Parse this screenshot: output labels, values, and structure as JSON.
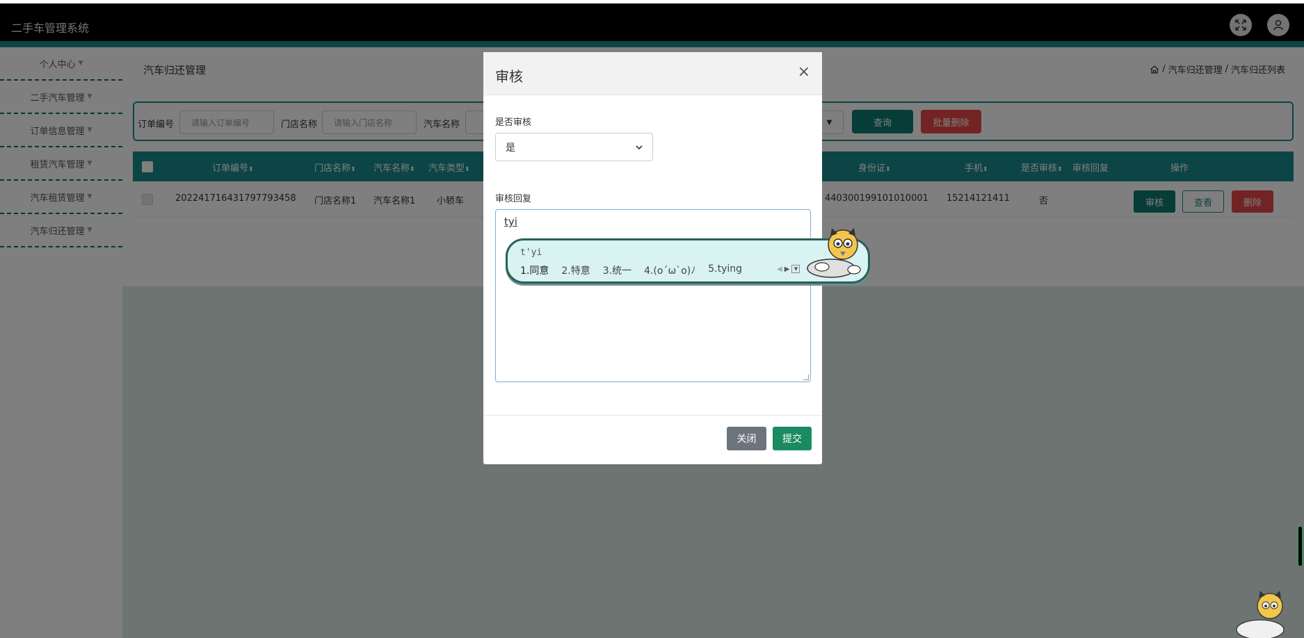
{
  "app": {
    "title": "二手车管理系统"
  },
  "sidebar": {
    "items": [
      {
        "label": "个人中心"
      },
      {
        "label": "二手汽车管理"
      },
      {
        "label": "订单信息管理"
      },
      {
        "label": "租赁汽车管理"
      },
      {
        "label": "汽车租赁管理"
      },
      {
        "label": "汽车归还管理"
      }
    ]
  },
  "page": {
    "title": "汽车归还管理",
    "breadcrumb": [
      "汽车归还管理",
      "汽车归还列表"
    ],
    "breadcrumb_sep": "/"
  },
  "search": {
    "order_label": "订单编号",
    "order_placeholder": "请输入订单编号",
    "store_label": "门店名称",
    "store_placeholder": "请输入门店名称",
    "car_label": "汽车名称",
    "query_button": "查询",
    "batch_delete_button": "批量删除"
  },
  "table": {
    "headers": [
      "订单编号",
      "门店名称",
      "汽车名称",
      "汽车类型",
      "身份证",
      "手机",
      "是否审核",
      "审核回复",
      "操作"
    ],
    "sort_icon": "⬍",
    "rows": [
      {
        "order_no": "202241716431797793458",
        "store": "门店名称1",
        "car": "汽车名称1",
        "type": "小轿车",
        "id_card": "440300199101010001",
        "phone": "15214121411",
        "audited": "否",
        "actions": {
          "audit": "审核",
          "view": "查看",
          "delete": "删除"
        }
      }
    ]
  },
  "modal": {
    "title": "审核",
    "close_glyph": "×",
    "audit_label": "是否审核",
    "audit_value": "是",
    "reply_label": "审核回复",
    "reply_value": "tyi",
    "close_button": "关闭",
    "submit_button": "提交"
  },
  "ime": {
    "input": "t'yi",
    "candidates": [
      "1.同意",
      "2.特意",
      "3.统一",
      "4.(o´ω`o)ﾉ",
      "5.tying"
    ]
  },
  "colors": {
    "primary": "#1b8a8c",
    "query": "#0f7b70",
    "danger": "#e54848",
    "submit": "#1a8a60"
  }
}
